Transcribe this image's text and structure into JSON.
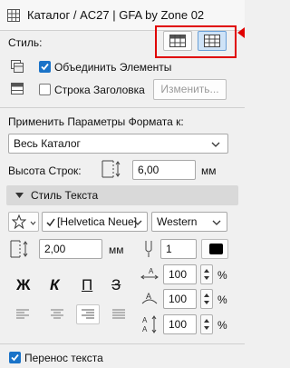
{
  "window": {
    "title": "Каталог / AC27 | GFA by Zone 02"
  },
  "style": {
    "label": "Стиль:",
    "merge_label": "Объединить Элементы",
    "merge_checked": true,
    "header_row_label": "Строка Заголовка",
    "header_row_checked": false,
    "modify_button": "Изменить..."
  },
  "apply": {
    "label": "Применить Параметры Формата к:",
    "selected": "Весь Каталог"
  },
  "row_height": {
    "label": "Высота Строк:",
    "value": "6,00",
    "unit": "мм"
  },
  "text_style": {
    "header": "Стиль Текста",
    "font": "[Helvetica Neue]",
    "script": "Western",
    "size_value": "2,00",
    "size_unit": "мм",
    "pen_value": "1",
    "bold": "Ж",
    "italic": "К",
    "underline": "П",
    "strike": "З",
    "width_scale": "100",
    "char_spacing": "100",
    "line_spacing": "100",
    "percent": "%",
    "wrap_label": "Перенос текста",
    "wrap_checked": true
  },
  "colors": {
    "accent": "#1a73c8",
    "highlight": "#e00000",
    "section_bg": "#d9d9d9"
  }
}
